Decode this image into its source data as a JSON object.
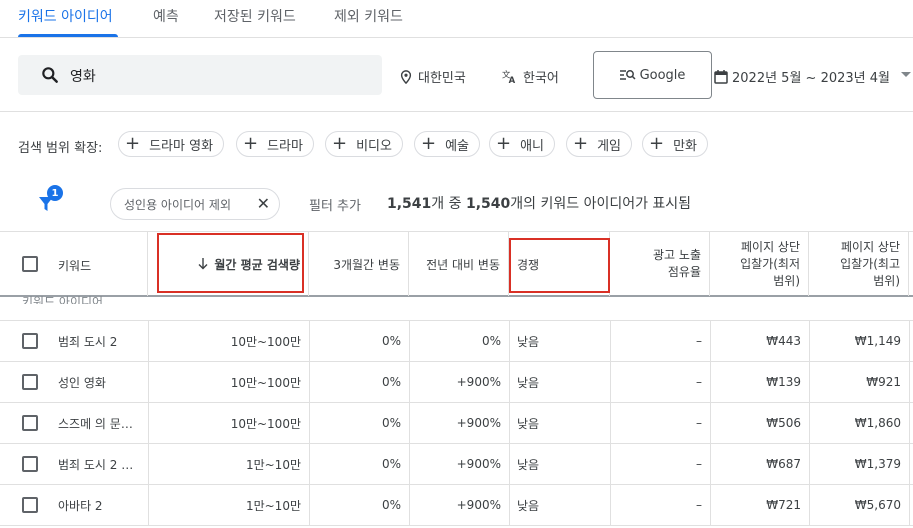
{
  "tabs": [
    {
      "label": "키워드 아이디어",
      "active": true
    },
    {
      "label": "예측",
      "active": false
    },
    {
      "label": "저장된 키워드",
      "active": false
    },
    {
      "label": "제외 키워드",
      "active": false
    }
  ],
  "search": {
    "value": "영화"
  },
  "location": "대한민국",
  "language": "한국어",
  "engine": "Google",
  "date_range": "2022년 5월 ~ 2023년 4월",
  "broaden": {
    "label": "검색 범위 확장:",
    "chips": [
      "드라마 영화",
      "드라마",
      "비디오",
      "예술",
      "애니",
      "게임",
      "만화"
    ]
  },
  "filters": {
    "badge": "1",
    "exclude_chip": "성인용 아이디어 제외",
    "add_filter": "필터 추가",
    "showing_prefix": "1,541",
    "showing_mid": "개 중 ",
    "showing_count": "1,540",
    "showing_suffix": "개의 키워드 아이디어가 표시됨"
  },
  "table": {
    "headers": {
      "keyword": "키워드",
      "avg_searches": "월간 평균 검색량",
      "three_month": "3개월간 변동",
      "yoy": "전년 대비 변동",
      "competition": "경쟁",
      "ad_share": "광고 노출 점유율",
      "bid_low": "페이지 상단 입찰가(최저 범위)",
      "bid_high": "페이지 상단 입찰가(최고 범위)"
    },
    "group_label": "키워드 아이디어",
    "rows": [
      {
        "keyword": "범죄 도시 2",
        "avg": "10만~100만",
        "three": "0%",
        "yoy": "0%",
        "comp": "낮음",
        "share": "–",
        "low": "₩443",
        "high": "₩1,149"
      },
      {
        "keyword": "성인 영화",
        "avg": "10만~100만",
        "three": "0%",
        "yoy": "+900%",
        "comp": "낮음",
        "share": "–",
        "low": "₩139",
        "high": "₩921"
      },
      {
        "keyword": "스즈메 의 문…",
        "avg": "10만~100만",
        "three": "0%",
        "yoy": "+900%",
        "comp": "낮음",
        "share": "–",
        "low": "₩506",
        "high": "₩1,860"
      },
      {
        "keyword": "범죄 도시 2 …",
        "avg": "1만~10만",
        "three": "0%",
        "yoy": "+900%",
        "comp": "낮음",
        "share": "–",
        "low": "₩687",
        "high": "₩1,379"
      },
      {
        "keyword": "아바타 2",
        "avg": "1만~10만",
        "three": "0%",
        "yoy": "+900%",
        "comp": "낮음",
        "share": "–",
        "low": "₩721",
        "high": "₩5,670"
      }
    ]
  },
  "colors": {
    "accent": "#1a73e8",
    "highlight": "#d93025"
  }
}
